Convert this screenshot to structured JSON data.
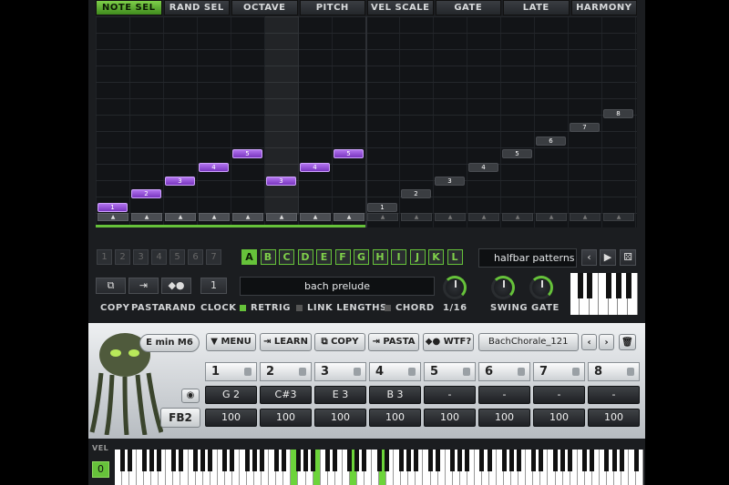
{
  "tabs": [
    "NOTE SEL",
    "RAND SEL",
    "OCTAVE",
    "PITCH",
    "VEL SCALE",
    "GATE",
    "LATE",
    "HARMONY"
  ],
  "active_tab": "NOTE SEL",
  "steps": [
    {
      "label": "1",
      "on": true
    },
    {
      "label": "2",
      "on": true
    },
    {
      "label": "3",
      "on": true
    },
    {
      "label": "4",
      "on": true
    },
    {
      "label": "5",
      "on": true
    },
    {
      "label": "3",
      "on": true
    },
    {
      "label": "4",
      "on": true
    },
    {
      "label": "5",
      "on": true
    },
    {
      "label": "1",
      "on": false
    },
    {
      "label": "2",
      "on": false
    },
    {
      "label": "3",
      "on": false
    },
    {
      "label": "4",
      "on": false
    },
    {
      "label": "5",
      "on": false
    },
    {
      "label": "6",
      "on": false
    },
    {
      "label": "7",
      "on": false
    },
    {
      "label": "8",
      "on": false
    }
  ],
  "step_levels": [
    0.0,
    0.1,
    0.2,
    0.3,
    0.4,
    0.2,
    0.3,
    0.4,
    0.0,
    0.1,
    0.2,
    0.3,
    0.4,
    0.5,
    0.6,
    0.7
  ],
  "seq_numbers": [
    "1",
    "2",
    "3",
    "4",
    "5",
    "6",
    "7"
  ],
  "left_buttons": {
    "copy": "COPY",
    "pasta": "PASTA",
    "rand": "RAND",
    "clock": "CLOCK",
    "clock_value": "1"
  },
  "letters": [
    "A",
    "B",
    "C",
    "D",
    "E",
    "F",
    "G",
    "H",
    "I",
    "J",
    "K",
    "L"
  ],
  "active_letter": "A",
  "pattern_name": "bach prelude",
  "options": {
    "retrig": "RETRIG",
    "link": "LINK LENGTHS",
    "chord": "CHORD",
    "rate": "1/16"
  },
  "preset_right": "halfbar patterns",
  "knobs": {
    "swing": "SWING",
    "gate": "GATE"
  },
  "chord_bar": {
    "key": "E  min M6",
    "menu": "MENU",
    "learn": "LEARN",
    "copy": "COPY",
    "pasta": "PASTA",
    "wtf": "WTF?",
    "preset": "BachChorale_121"
  },
  "chord_slots": [
    {
      "num": "1",
      "note": "G 2",
      "vel": "100"
    },
    {
      "num": "2",
      "note": "C#3",
      "vel": "100"
    },
    {
      "num": "3",
      "note": "E 3",
      "vel": "100"
    },
    {
      "num": "4",
      "note": "B 3",
      "vel": "100"
    },
    {
      "num": "5",
      "note": "-",
      "vel": "100"
    },
    {
      "num": "6",
      "note": "-",
      "vel": "100"
    },
    {
      "num": "7",
      "note": "-",
      "vel": "100"
    },
    {
      "num": "8",
      "note": "-",
      "vel": "100"
    }
  ],
  "fb": "FB2",
  "vel_label": "VEL",
  "vel_value": "0",
  "colors": {
    "accent": "#66c23a",
    "step_on": "#9a55dd"
  }
}
